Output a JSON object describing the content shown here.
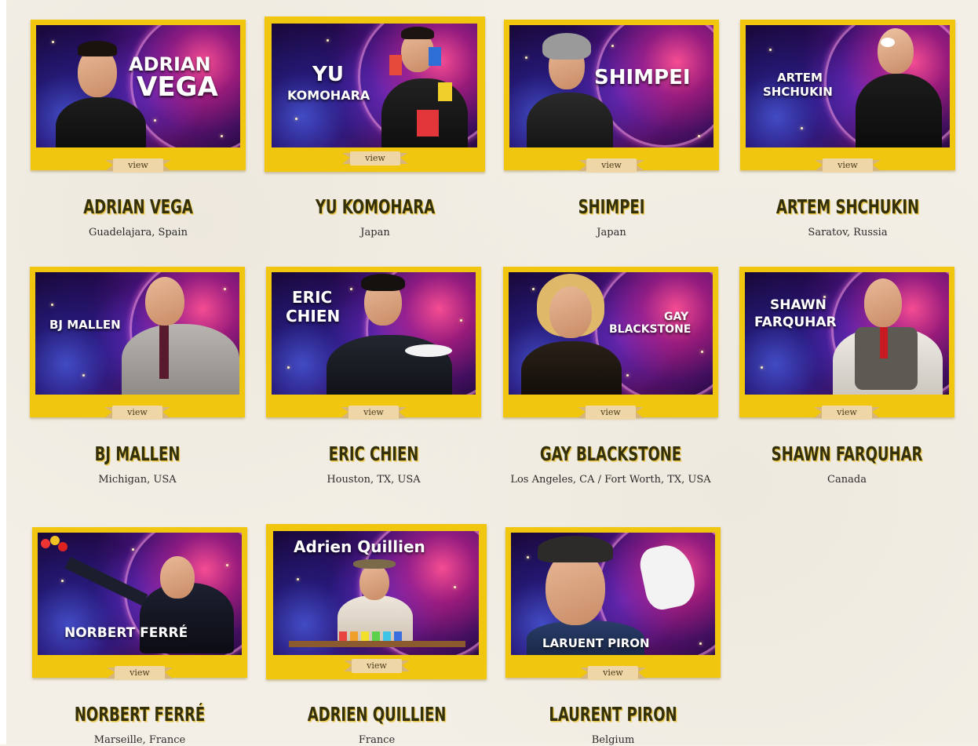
{
  "page": {
    "view_label": "view",
    "colors": {
      "frame_gold": "#f0c60f",
      "name_dark": "#34300a",
      "name_shadow": "#e7c23a",
      "ribbon_tan": "#efd6a6"
    }
  },
  "artists": [
    {
      "name": "ADRIAN VEGA",
      "location": "Guadelajara, Spain",
      "photo_title_lines": [
        "Adrian",
        "Vega"
      ]
    },
    {
      "name": "YU KOMOHARA",
      "location": "Japan",
      "photo_title_lines": [
        "Yu",
        "Komohara"
      ]
    },
    {
      "name": "SHIMPEI",
      "location": "Japan",
      "photo_title_lines": [
        "Shimpei"
      ]
    },
    {
      "name": "ARTEM SHCHUKIN",
      "location": "Saratov, Russia",
      "photo_title_lines": [
        "Artem",
        "Shchukin"
      ]
    },
    {
      "name": "BJ MALLEN",
      "location": "Michigan, USA",
      "photo_title_lines": [
        "BJ Mallen"
      ]
    },
    {
      "name": "ERIC CHIEN",
      "location": "Houston, TX, USA",
      "photo_title_lines": [
        "Eric",
        "Chien"
      ]
    },
    {
      "name": "GAY BLACKSTONE",
      "location": "Los Angeles, CA / Fort Worth, TX, USA",
      "photo_title_lines": [
        "Gay",
        "Blackstone"
      ]
    },
    {
      "name": "SHAWN FARQUHAR",
      "location": "Canada",
      "photo_title_lines": [
        "Shawn",
        "Farquhar"
      ]
    },
    {
      "name": "NORBERT FERRÉ",
      "location": "Marseille, France",
      "photo_title_lines": [
        "Norbert Ferré"
      ]
    },
    {
      "name": "ADRIEN QUILLIEN",
      "location": "France",
      "photo_title_lines": [
        "Adrien Quillien"
      ]
    },
    {
      "name": "LAURENT PIRON",
      "location": "Belgium",
      "photo_title_lines": [
        "Laruent Piron"
      ]
    }
  ]
}
